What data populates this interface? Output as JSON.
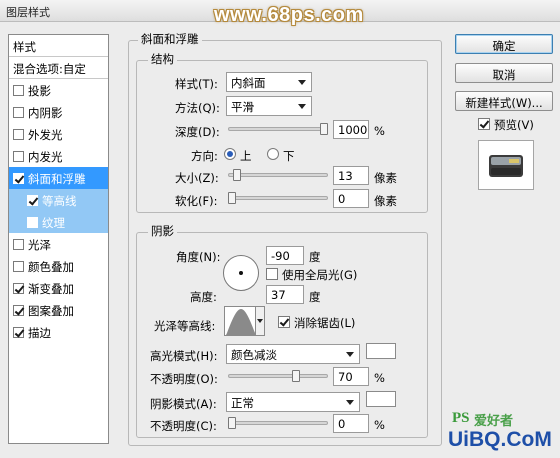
{
  "window": {
    "title": "图层样式"
  },
  "watermark": "www.68ps.com",
  "style_list": {
    "header": "样式",
    "blend_options": "混合选项:自定",
    "items": [
      {
        "label": "投影",
        "checked": false
      },
      {
        "label": "内阴影",
        "checked": false
      },
      {
        "label": "外发光",
        "checked": false
      },
      {
        "label": "内发光",
        "checked": false
      },
      {
        "label": "斜面和浮雕",
        "checked": true,
        "selected": true
      },
      {
        "label": "等高线",
        "checked": true,
        "sub": true
      },
      {
        "label": "纹理",
        "checked": false,
        "sub": true
      },
      {
        "label": "光泽",
        "checked": false
      },
      {
        "label": "颜色叠加",
        "checked": false
      },
      {
        "label": "渐变叠加",
        "checked": true
      },
      {
        "label": "图案叠加",
        "checked": true
      },
      {
        "label": "描边",
        "checked": true
      }
    ]
  },
  "bevel": {
    "title": "斜面和浮雕",
    "structure": {
      "title": "结构",
      "style_label": "样式(T):",
      "style_value": "内斜面",
      "technique_label": "方法(Q):",
      "technique_value": "平滑",
      "depth_label": "深度(D):",
      "depth_value": "1000",
      "depth_unit": "%",
      "depth_level": 1.0,
      "direction_label": "方向:",
      "direction_up": "上",
      "direction_down": "下",
      "direction_selected": "上",
      "size_label": "大小(Z):",
      "size_value": "13",
      "size_unit": "像素",
      "size_level": 0.05,
      "soften_label": "软化(F):",
      "soften_value": "0",
      "soften_unit": "像素",
      "soften_level": 0.0
    },
    "shading": {
      "title": "阴影",
      "angle_label": "角度(N):",
      "angle_value": "-90",
      "angle_unit": "度",
      "global_light_label": "使用全局光(G)",
      "global_light_checked": false,
      "altitude_label": "高度:",
      "altitude_value": "37",
      "altitude_unit": "度",
      "gloss_contour_label": "光泽等高线:",
      "antialias_label": "消除锯齿(L)",
      "antialias_checked": true,
      "highlight_mode_label": "高光模式(H):",
      "highlight_mode_value": "颜色减淡",
      "highlight_color": "#ffffff",
      "highlight_opacity_label": "不透明度(O):",
      "highlight_opacity_value": "70",
      "highlight_opacity_unit": "%",
      "highlight_opacity_level": 0.7,
      "shadow_mode_label": "阴影模式(A):",
      "shadow_mode_value": "正常",
      "shadow_color": "#ffffff",
      "shadow_opacity_label": "不透明度(C):",
      "shadow_opacity_value": "0",
      "shadow_opacity_unit": "%",
      "shadow_opacity_level": 0.0
    }
  },
  "buttons": {
    "ok": "确定",
    "cancel": "取消",
    "new_style": "新建样式(W)...",
    "preview_label": "预览(V)",
    "preview_checked": true
  },
  "logo": {
    "ps": "PS",
    "text": "爱好者",
    "uibq": "UiBQ.CoM"
  }
}
